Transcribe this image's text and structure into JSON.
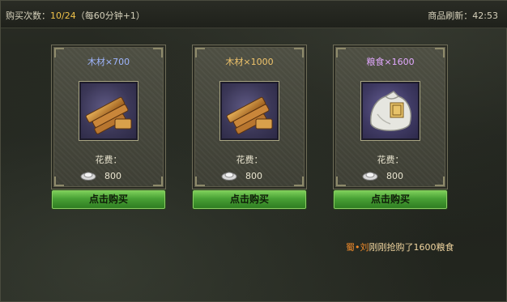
{
  "header": {
    "count_label": "购买次数：",
    "count_value": "10/24",
    "count_note": "（每60分钟+1）",
    "refresh_label": "商品刷新：",
    "refresh_time": "42:53"
  },
  "items": [
    {
      "title": "木材×700",
      "cost_label": "花费：",
      "cost_value": "800",
      "button_label": "点击购买",
      "icon": "wood-planks-icon"
    },
    {
      "title": "木材×1000",
      "cost_label": "花费：",
      "cost_value": "800",
      "button_label": "点击购买",
      "icon": "wood-planks-icon"
    },
    {
      "title": "粮食×1600",
      "cost_label": "花费：",
      "cost_value": "800",
      "button_label": "点击购买",
      "icon": "grain-sack-icon"
    }
  ],
  "notice": {
    "player": "蜀•刘",
    "message": "刚刚抢购了1600粮食"
  }
}
